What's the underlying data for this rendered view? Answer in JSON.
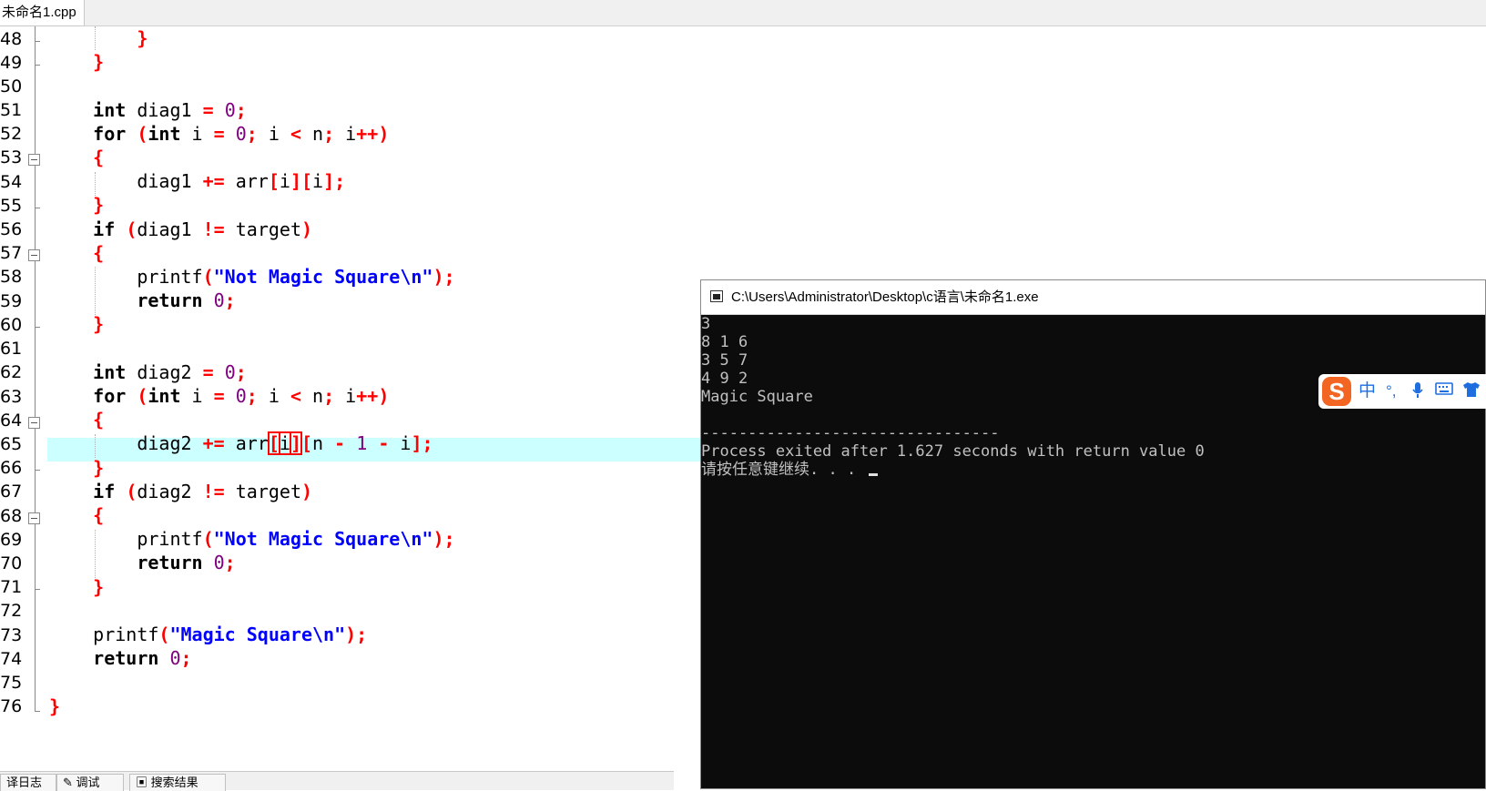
{
  "tab": {
    "filename": "未命名1.cpp"
  },
  "editor": {
    "line_numbers": [
      "48",
      "49",
      "50",
      "51",
      "52",
      "53",
      "54",
      "55",
      "56",
      "57",
      "58",
      "59",
      "60",
      "61",
      "62",
      "63",
      "64",
      "65",
      "66",
      "67",
      "68",
      "69",
      "70",
      "71",
      "72",
      "73",
      "74",
      "75",
      "76"
    ],
    "current_line": "65"
  },
  "bottom_tabs": [
    "译日志",
    "调试",
    "搜索结果"
  ],
  "console": {
    "title": "C:\\Users\\Administrator\\Desktop\\c语言\\未命名1.exe",
    "lines": [
      "3",
      "8 1 6",
      "3 5 7",
      "4 9 2",
      "Magic Square",
      "",
      "--------------------------------",
      "Process exited after 1.627 seconds with return value 0",
      "请按任意键继续. . . "
    ]
  },
  "ime": {
    "logo": "S",
    "mode": "中",
    "punct": "°,",
    "icons": [
      "microphone-icon",
      "keyboard-icon",
      "shirt-icon"
    ],
    "brand_color": "#f26522",
    "icon_color": "#1e6ee0"
  },
  "colors": {
    "keyword": "#000000",
    "symbol": "#ff0000",
    "number": "#800080",
    "string": "#0000ff",
    "current_line_bg": "#ccffff"
  }
}
